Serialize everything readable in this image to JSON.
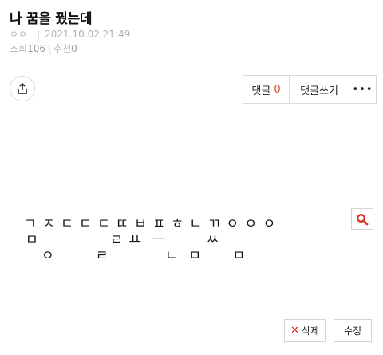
{
  "post": {
    "title": "나 꿈을 꿨는데",
    "author": "ㅇㅇ",
    "date": "2021.10.02 21:49",
    "views_label": "조회",
    "views": "106",
    "recommend_label": "추천",
    "recommend": "0",
    "body_lines": [
      "ㄱ ㅈ ㄷ ㄷ ㄷ ㄸ ㅂ ㅍ ㅎ ㄴ ㄲ ㅇ ㅇ ㅇ",
      "ㅁ              ㄹ ㅛ  ㅡ        ㅆ",
      "ㅇ        ㄹ           ㄴ  ㅁ      ㅁ"
    ]
  },
  "toolbar": {
    "comment_label": "댓글",
    "comment_count": "0",
    "write_comment_label": "댓글쓰기",
    "more_label": "•••"
  },
  "footer": {
    "delete_label": "삭제",
    "edit_label": "수정"
  },
  "colors": {
    "accent": "#e0462b",
    "delete_x": "#e0251b",
    "search_icon": "#d9372b"
  }
}
